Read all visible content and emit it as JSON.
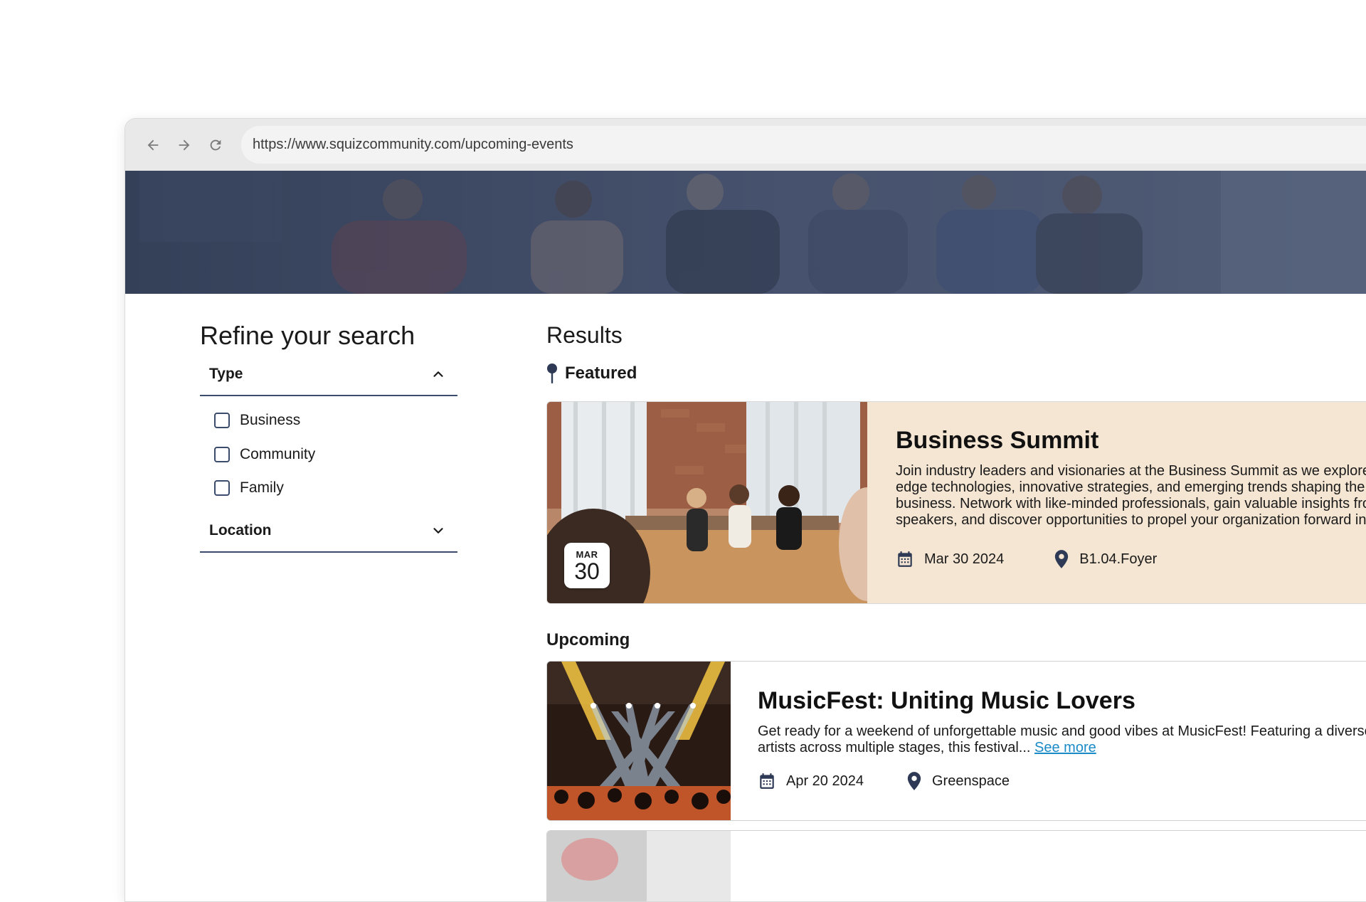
{
  "browser": {
    "url": "https://www.squizcommunity.com/upcoming-events"
  },
  "sidebar": {
    "title": "Refine your search",
    "facets": [
      {
        "label": "Type",
        "expanded": true,
        "options": [
          "Business",
          "Community",
          "Family"
        ]
      },
      {
        "label": "Location",
        "expanded": false
      }
    ]
  },
  "main": {
    "title": "Results",
    "featured": {
      "heading": "Featured",
      "event": {
        "badge_month": "MAR",
        "badge_day": "30",
        "title": "Business Summit",
        "description": "Join industry leaders and visionaries at the Business Summit as we explore cutting-edge technologies, innovative strategies, and emerging trends shaping the future of business. Network with like-minded professionals, gain valuable insights from keynote speakers, and discover opportunities to propel your organization forward into the future.",
        "date": "Mar 30 2024",
        "location": "B1.04.Foyer"
      }
    },
    "upcoming": {
      "heading": "Upcoming",
      "events": [
        {
          "title": "MusicFest: Uniting Music Lovers",
          "description": "Get ready for a weekend of unforgettable music and good vibes at MusicFest! Featuring a diverse lineup of artists across multiple stages, this festival...",
          "see_more": "See more",
          "date": "Apr 20 2024",
          "location": "Greenspace"
        }
      ]
    }
  },
  "colors": {
    "accent_navy": "#3b4b6b",
    "featured_bg": "#f5e6d3",
    "link": "#1a8bc7",
    "hero_overlay": "#3e4a63"
  },
  "icons": [
    "back-arrow-icon",
    "forward-arrow-icon",
    "reload-icon",
    "chevron-up-icon",
    "chevron-down-icon",
    "pin-icon",
    "calendar-icon",
    "location-marker-icon"
  ]
}
